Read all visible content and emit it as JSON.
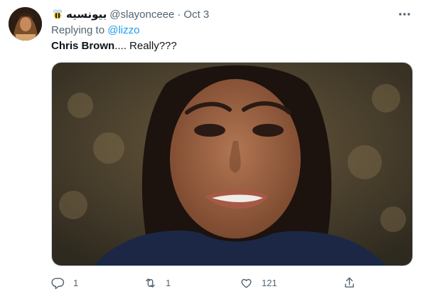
{
  "tweet": {
    "display_name": "بيونسيه",
    "handle": "@slayonceee",
    "separator": "·",
    "time": "Oct 3",
    "replying_prefix": "Replying to",
    "replying_to": "@lizzo",
    "text_bold": "Chris Brown",
    "text_rest": ".... Really???"
  },
  "actions": {
    "reply_count": "1",
    "retweet_count": "1",
    "like_count": "121"
  },
  "icons": [
    "bee-icon",
    "more-icon",
    "reply-icon",
    "retweet-icon",
    "like-icon",
    "share-icon"
  ],
  "colors": {
    "link": "#1d9bf0",
    "muted": "#536471",
    "text": "#0f1419"
  }
}
